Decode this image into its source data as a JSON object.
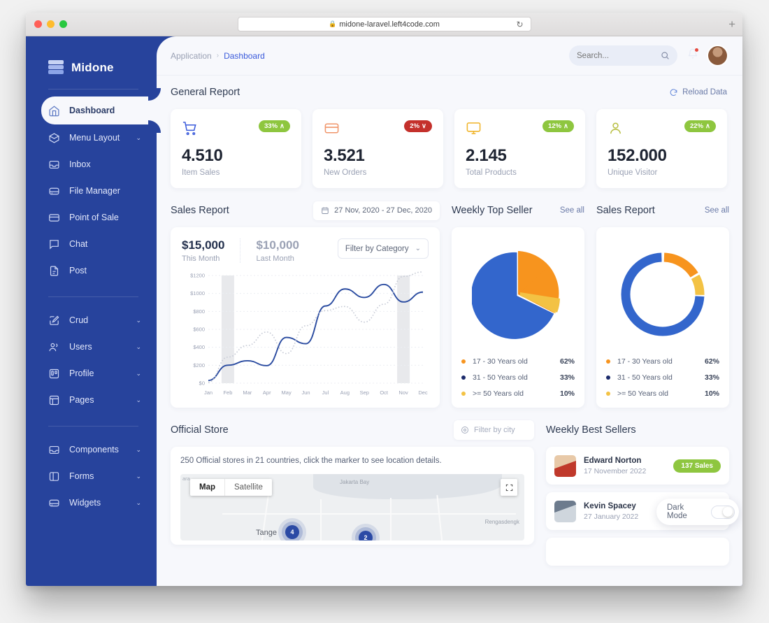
{
  "browser": {
    "url": "midone-laravel.left4code.com",
    "lock_icon": "lock-icon",
    "reload_icon": "reload-icon",
    "new_tab_label": "+"
  },
  "brand": {
    "name": "Midone",
    "logo_icon": "layers-logo-icon"
  },
  "sidebar": {
    "items": [
      {
        "label": "Dashboard",
        "icon": "home-icon",
        "active": true,
        "caret": false
      },
      {
        "label": "Menu Layout",
        "icon": "box-icon",
        "active": false,
        "caret": true
      },
      {
        "label": "Inbox",
        "icon": "inbox-icon",
        "active": false,
        "caret": false
      },
      {
        "label": "File Manager",
        "icon": "hard-drive-icon",
        "active": false,
        "caret": false
      },
      {
        "label": "Point of Sale",
        "icon": "credit-card-icon",
        "active": false,
        "caret": false
      },
      {
        "label": "Chat",
        "icon": "message-icon",
        "active": false,
        "caret": false
      },
      {
        "label": "Post",
        "icon": "file-text-icon",
        "active": false,
        "caret": false
      }
    ],
    "items2": [
      {
        "label": "Crud",
        "icon": "edit-icon",
        "caret": true
      },
      {
        "label": "Users",
        "icon": "users-icon",
        "caret": true
      },
      {
        "label": "Profile",
        "icon": "trello-icon",
        "caret": true
      },
      {
        "label": "Pages",
        "icon": "layout-icon",
        "caret": true
      }
    ],
    "items3": [
      {
        "label": "Components",
        "icon": "inbox-icon",
        "caret": true
      },
      {
        "label": "Forms",
        "icon": "sidebar-icon",
        "caret": true
      },
      {
        "label": "Widgets",
        "icon": "hard-drive-icon",
        "caret": true
      }
    ],
    "caret_glyph": "⌄"
  },
  "topbar": {
    "breadcrumb_root": "Application",
    "breadcrumb_sep": "›",
    "breadcrumb_current": "Dashboard",
    "search_placeholder": "Search...",
    "search_value": "",
    "search_icon": "search-icon",
    "bell_icon": "bell-icon",
    "avatar": "user-avatar"
  },
  "general_report": {
    "title": "General Report",
    "reload_label": "Reload Data",
    "reload_icon": "refresh-icon",
    "cards": [
      {
        "icon": "shopping-cart-icon",
        "icon_color": "#3b5bdb",
        "value": "4.510",
        "label": "Item Sales",
        "badge": "33%",
        "badge_dir": "∧",
        "badge_color": "#8ec63f"
      },
      {
        "icon": "credit-card-icon",
        "icon_color": "#f0956a",
        "value": "3.521",
        "label": "New Orders",
        "badge": "2%",
        "badge_dir": "∨",
        "badge_color": "#c4302b"
      },
      {
        "icon": "monitor-icon",
        "icon_color": "#f0b429",
        "value": "2.145",
        "label": "Total Products",
        "badge": "12%",
        "badge_dir": "∧",
        "badge_color": "#8ec63f"
      },
      {
        "icon": "user-icon",
        "icon_color": "#b8bf43",
        "value": "152.000",
        "label": "Unique Visitor",
        "badge": "22%",
        "badge_dir": "∧",
        "badge_color": "#8ec63f"
      }
    ]
  },
  "sales_report": {
    "title": "Sales Report",
    "date_range": "27 Nov, 2020 - 27 Dec, 2020",
    "calendar_icon": "calendar-icon",
    "this_month_value": "$15,000",
    "this_month_label": "This Month",
    "last_month_value": "$10,000",
    "last_month_label": "Last Month",
    "filter_label": "Filter by Category",
    "filter_caret": "⌄"
  },
  "weekly_top_seller": {
    "title": "Weekly Top Seller",
    "see_all": "See all",
    "legend": [
      {
        "label": "17 - 30 Years old",
        "pct": "62%",
        "color": "#f7941e"
      },
      {
        "label": "31 - 50 Years old",
        "pct": "33%",
        "color": "#1b2a6b"
      },
      {
        "label": ">= 50 Years old",
        "pct": "10%",
        "color": "#f3c244"
      }
    ]
  },
  "sales_report_donut": {
    "title": "Sales Report",
    "see_all": "See all",
    "legend": [
      {
        "label": "17 - 30 Years old",
        "pct": "62%",
        "color": "#f7941e"
      },
      {
        "label": "31 - 50 Years old",
        "pct": "33%",
        "color": "#1b2a6b"
      },
      {
        "label": ">= 50 Years old",
        "pct": "10%",
        "color": "#f3c244"
      }
    ]
  },
  "official_store": {
    "title": "Official Store",
    "filter_placeholder": "Filter by city",
    "filter_value": "",
    "pin_icon": "map-pin-icon",
    "note": "250 Official stores in 21 countries, click the marker to see location details.",
    "map_type_map": "Map",
    "map_type_satellite": "Satellite",
    "fullscreen_icon": "fullscreen-icon",
    "labels": {
      "bay": "Jakarta Bay",
      "rengas": "Rengasdengk",
      "tangerang": "Tange",
      "ara": "ara"
    },
    "markers": [
      {
        "count": "4"
      },
      {
        "count": "2"
      }
    ]
  },
  "weekly_best_sellers": {
    "title": "Weekly Best Sellers",
    "sellers": [
      {
        "name": "Edward Norton",
        "date": "17 November 2022",
        "sales": "137 Sales"
      },
      {
        "name": "Kevin Spacey",
        "date": "27 January 2022",
        "sales": ""
      }
    ],
    "dark_mode_label": "Dark Mode",
    "dark_mode_on": false
  },
  "chart_data": [
    {
      "type": "line",
      "title": "Sales Report",
      "x": [
        "Jan",
        "Feb",
        "Mar",
        "Apr",
        "May",
        "Jun",
        "Jul",
        "Aug",
        "Sep",
        "Oct",
        "Nov",
        "Dec"
      ],
      "ylabel": "",
      "xlabel": "",
      "ylim": [
        0,
        1200
      ],
      "yticks": [
        "$0",
        "$200",
        "$400",
        "$600",
        "$800",
        "$1000",
        "$1200"
      ],
      "grid": true,
      "legend_position": "none",
      "series": [
        {
          "name": "This Month",
          "style": "solid",
          "color": "#2a4ba0",
          "values": [
            30,
            200,
            250,
            195,
            510,
            440,
            860,
            1050,
            955,
            1100,
            905,
            1015
          ]
        },
        {
          "name": "Last Month",
          "style": "dotted",
          "color": "#c7cbd6",
          "values": [
            10,
            290,
            420,
            570,
            330,
            640,
            810,
            855,
            680,
            880,
            1190,
            1240
          ]
        }
      ],
      "highlight_bands": [
        "Feb",
        "Nov"
      ]
    },
    {
      "type": "pie",
      "title": "Weekly Top Seller",
      "labels": [
        "17 - 30 Years old",
        "31 - 50 Years old",
        ">= 50 Years old"
      ],
      "values": [
        62,
        33,
        10
      ],
      "display_percents": [
        "62%",
        "33%",
        "10%"
      ],
      "colors": [
        "#f7941e",
        "#1b2a6b",
        "#f3c244"
      ],
      "slice_render_colors": [
        "#f7941e",
        "#3366cc",
        "#f3c244"
      ],
      "legend_position": "bottom"
    },
    {
      "type": "pie",
      "subtype": "donut",
      "title": "Sales Report",
      "labels": [
        "17 - 30 Years old",
        "31 - 50 Years old",
        ">= 50 Years old"
      ],
      "values": [
        62,
        33,
        10
      ],
      "display_percents": [
        "62%",
        "33%",
        "10%"
      ],
      "colors": [
        "#f7941e",
        "#1b2a6b",
        "#f3c244"
      ],
      "slice_render_colors": [
        "#f7941e",
        "#3366cc",
        "#f3c244"
      ],
      "legend_position": "bottom"
    }
  ]
}
